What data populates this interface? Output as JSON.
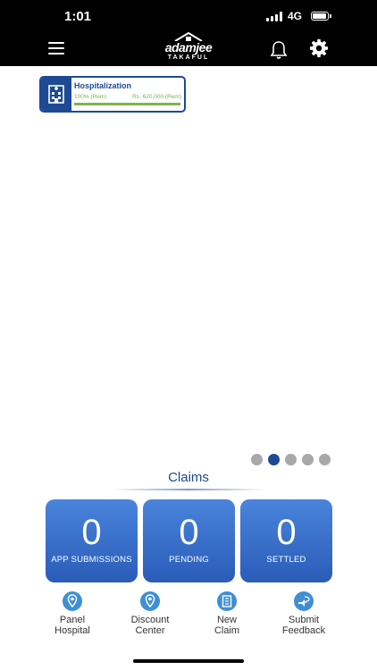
{
  "status_bar": {
    "time": "1:01",
    "network": "4G"
  },
  "header": {
    "logo_text": "adamjee",
    "logo_subtext": "TAKAFUL"
  },
  "coverage_card": {
    "title": "Hospitalization",
    "percent_text": "100% (Rem)",
    "amount_text": "Rs. 620,000 (Rem)",
    "remaining_fraction": 1.0,
    "icon": "hospital-icon"
  },
  "pager": {
    "count": 5,
    "active_index": 1
  },
  "claims": {
    "title": "Claims",
    "tiles": [
      {
        "count": "0",
        "label": "APP SUBMISSIONS"
      },
      {
        "count": "0",
        "label": "PENDING"
      },
      {
        "count": "0",
        "label": "SETTLED"
      }
    ]
  },
  "actions": [
    {
      "line1": "Panel",
      "line2": "Hospital",
      "icon": "location-pin-icon"
    },
    {
      "line1": "Discount",
      "line2": "Center",
      "icon": "location-pin-icon"
    },
    {
      "line1": "New",
      "line2": "Claim",
      "icon": "claim-form-icon"
    },
    {
      "line1": "Submit",
      "line2": "Feedback",
      "icon": "feedback-icon"
    }
  ],
  "colors": {
    "primary": "#1d4a93",
    "accent_green": "#7ab648",
    "tile_blue": "#2f64c0",
    "icon_blue": "#3e8fd4"
  }
}
